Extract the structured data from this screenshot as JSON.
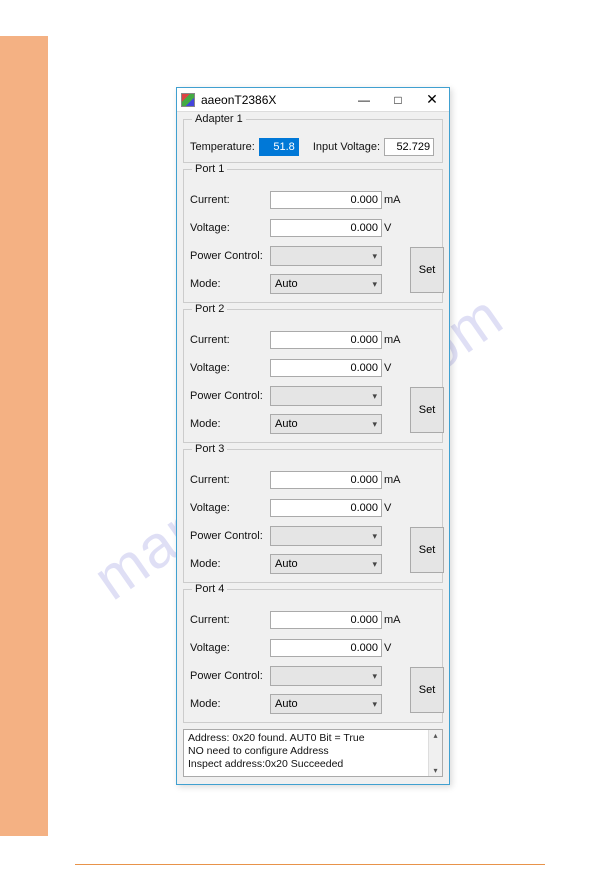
{
  "watermark": "manualshive.com",
  "window": {
    "title": "aaeonT2386X",
    "min": "—",
    "max": "□",
    "close": "✕"
  },
  "adapter": {
    "title": "Adapter 1",
    "tempLabel": "Temperature:",
    "tempValue": "51.8",
    "voltLabel": "Input Voltage:",
    "voltValue": "52.729"
  },
  "ports": [
    {
      "title": "Port 1",
      "currentLabel": "Current:",
      "currentValue": "0.000",
      "currentUnit": "mA",
      "voltageLabel": "Voltage:",
      "voltageValue": "0.000",
      "voltageUnit": "V",
      "powerLabel": "Power Control:",
      "powerValue": "",
      "modeLabel": "Mode:",
      "modeValue": "Auto",
      "setLabel": "Set"
    },
    {
      "title": "Port 2",
      "currentLabel": "Current:",
      "currentValue": "0.000",
      "currentUnit": "mA",
      "voltageLabel": "Voltage:",
      "voltageValue": "0.000",
      "voltageUnit": "V",
      "powerLabel": "Power Control:",
      "powerValue": "",
      "modeLabel": "Mode:",
      "modeValue": "Auto",
      "setLabel": "Set"
    },
    {
      "title": "Port 3",
      "currentLabel": "Current:",
      "currentValue": "0.000",
      "currentUnit": "mA",
      "voltageLabel": "Voltage:",
      "voltageValue": "0.000",
      "voltageUnit": "V",
      "powerLabel": "Power Control:",
      "powerValue": "",
      "modeLabel": "Mode:",
      "modeValue": "Auto",
      "setLabel": "Set"
    },
    {
      "title": "Port 4",
      "currentLabel": "Current:",
      "currentValue": "0.000",
      "currentUnit": "mA",
      "voltageLabel": "Voltage:",
      "voltageValue": "0.000",
      "voltageUnit": "V",
      "powerLabel": "Power Control:",
      "powerValue": "",
      "modeLabel": "Mode:",
      "modeValue": "Auto",
      "setLabel": "Set"
    }
  ],
  "log": {
    "line1": "Address: 0x20 found. AUT0 Bit = True",
    "line2": "NO need to configure Address",
    "line3": "Inspect address:0x20 Succeeded"
  }
}
